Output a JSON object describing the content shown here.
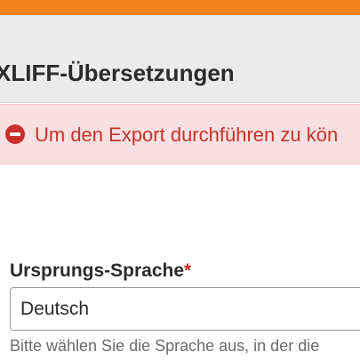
{
  "header": {
    "accent_color": "#f5821f",
    "title": "XLIFF-Übersetzungen"
  },
  "alert": {
    "icon": "error-icon",
    "color": "#c9302c",
    "message": "Um den Export durchführen zu kön"
  },
  "form": {
    "source_language": {
      "label": "Ursprungs-Sprache",
      "required_marker": "*",
      "value": "Deutsch",
      "help": "Bitte wählen Sie die Sprache aus, in der die"
    }
  }
}
